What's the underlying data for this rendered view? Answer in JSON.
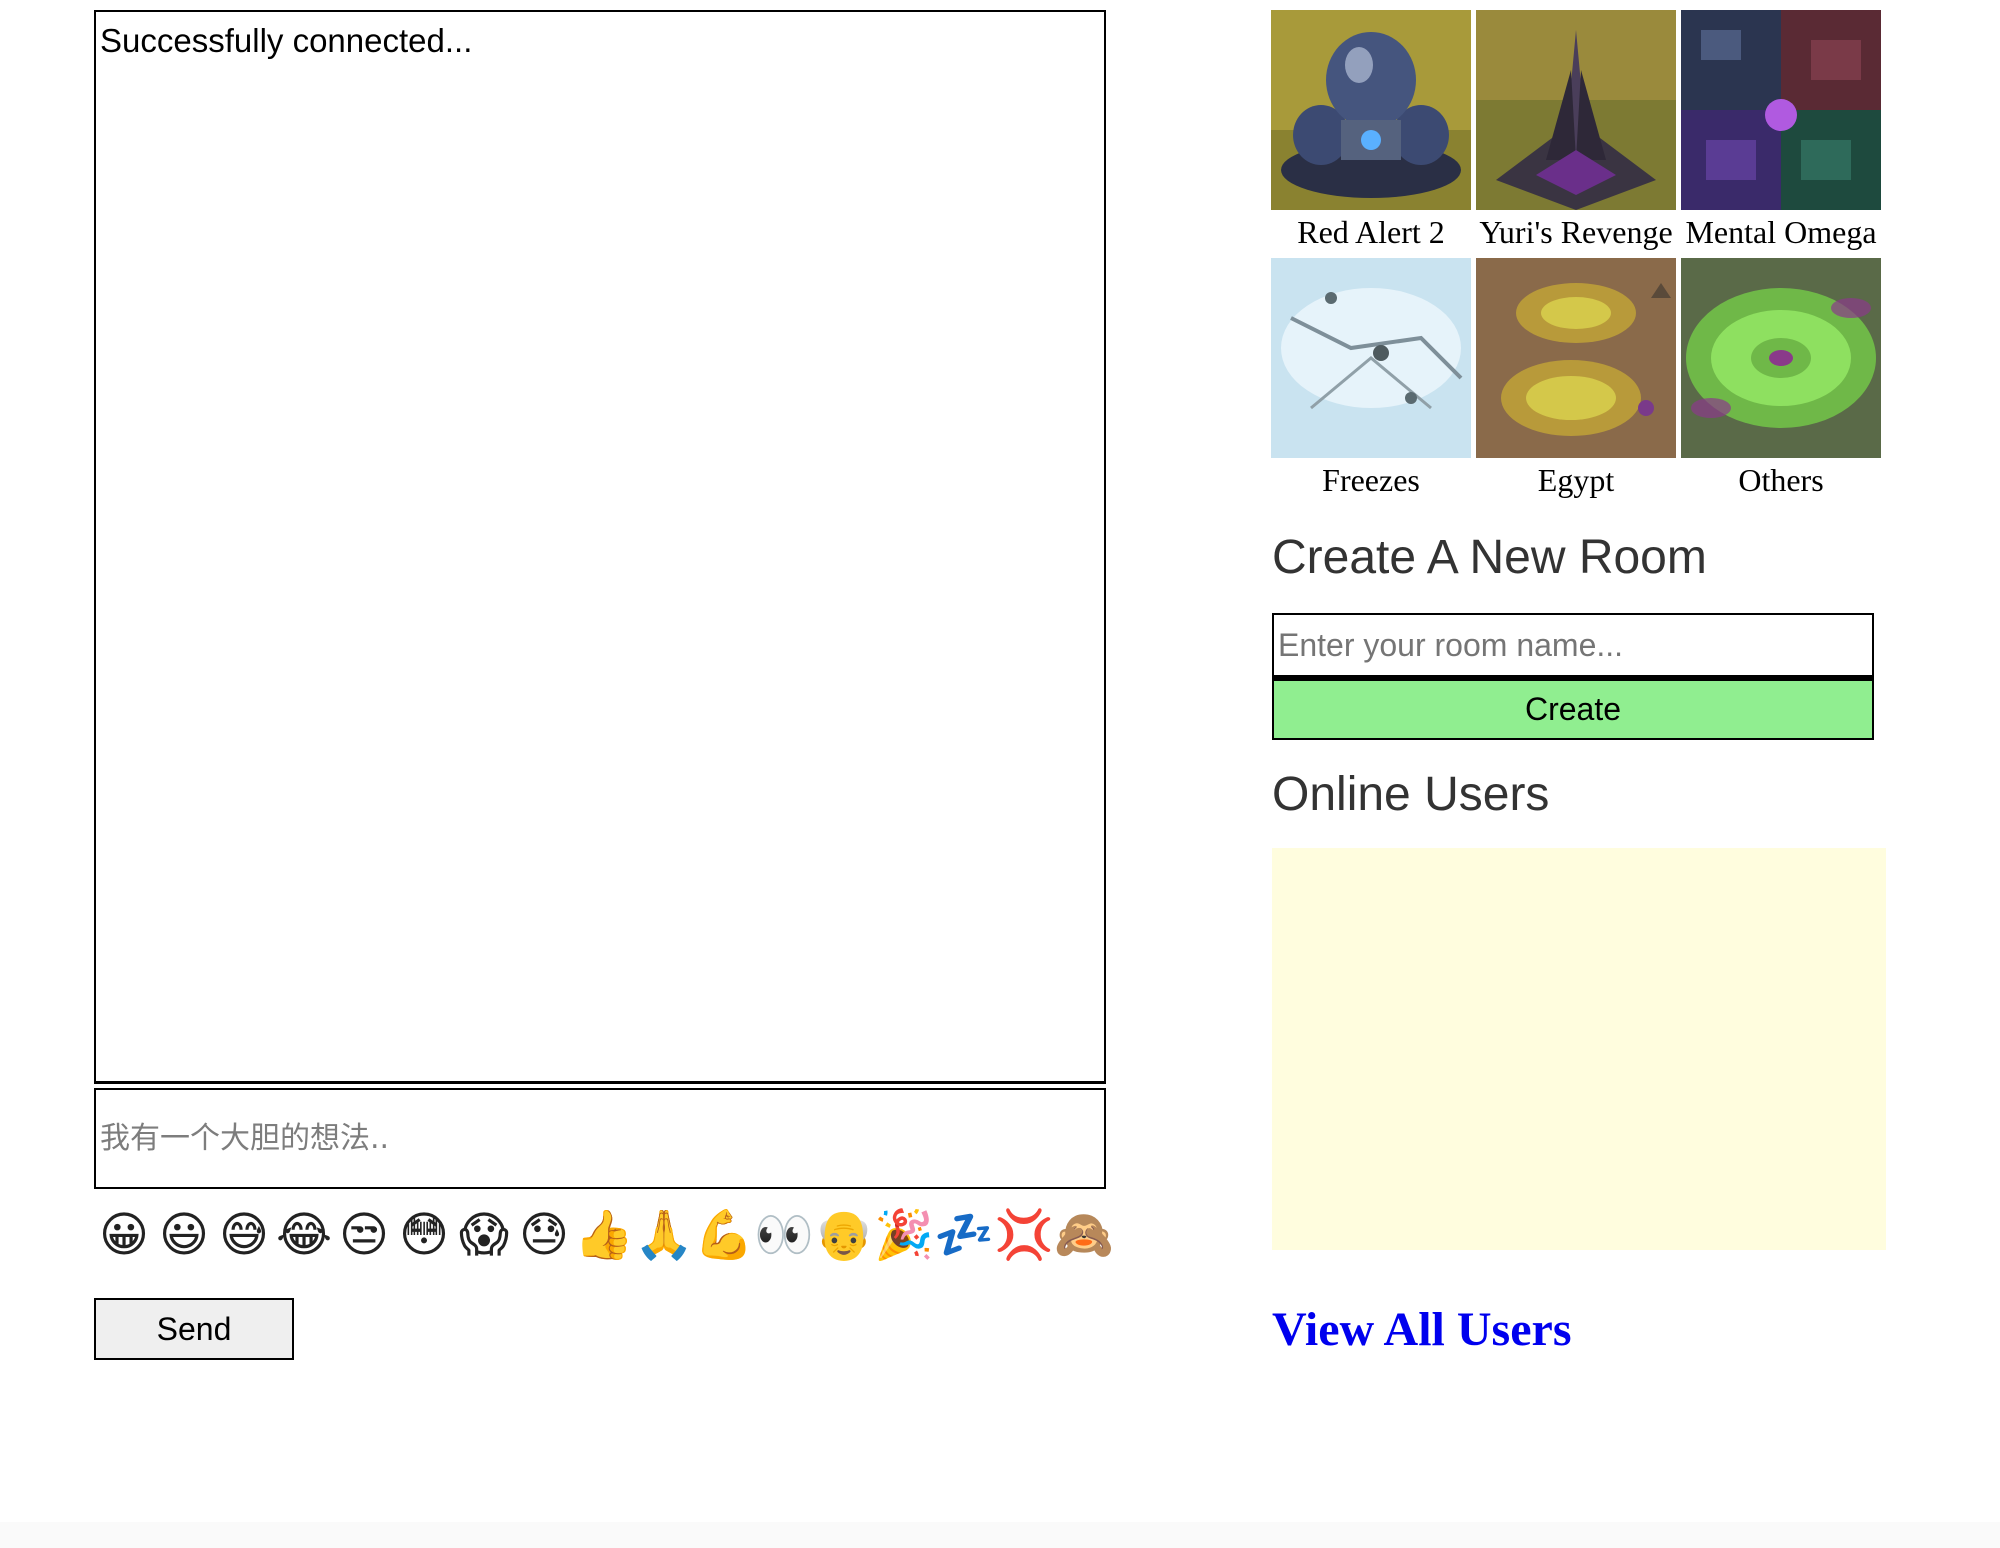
{
  "chat": {
    "messages": [
      "Successfully connected..."
    ],
    "input_placeholder": "我有一个大胆的想法..",
    "emojis": [
      "😀",
      "😃",
      "😅",
      "😂",
      "😒",
      "😳",
      "😱",
      "😓",
      "👍",
      "🙏",
      "💪",
      "👀",
      "👴",
      "🎉",
      "💤",
      "💢",
      "🙈"
    ],
    "send_label": "Send"
  },
  "games": [
    {
      "label": "Red Alert 2",
      "thumb_icon": "dome-building-icon"
    },
    {
      "label": "Yuri's Revenge",
      "thumb_icon": "psychic-tower-icon"
    },
    {
      "label": "Mental Omega",
      "thumb_icon": "mental-omega-collage-icon"
    },
    {
      "label": "Freezes",
      "thumb_icon": "snow-map-icon"
    },
    {
      "label": "Egypt",
      "thumb_icon": "desert-map-icon"
    },
    {
      "label": "Others",
      "thumb_icon": "green-map-icon"
    }
  ],
  "create_room": {
    "heading": "Create A New Room",
    "input_placeholder": "Enter your room name...",
    "button_label": "Create"
  },
  "online_users": {
    "heading": "Online Users",
    "users": []
  },
  "view_all_users_label": "View All Users",
  "colors": {
    "create_button": "#90ee90",
    "online_users_panel": "#fffdde",
    "link": "#0000ee"
  }
}
